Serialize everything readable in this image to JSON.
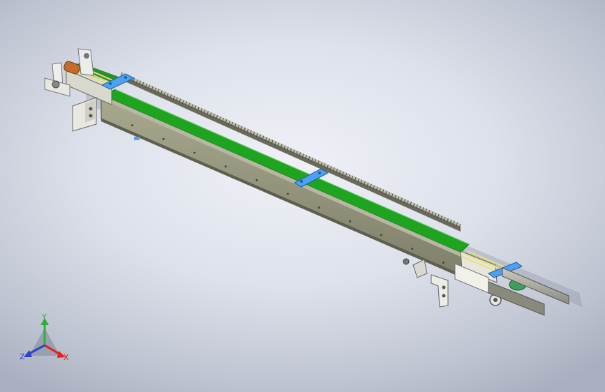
{
  "view": {
    "background_top": "#eef0f6",
    "background_bottom": "#aab0c0"
  },
  "triad": {
    "x_label": "X",
    "y_label": "Y",
    "z_label": "Z",
    "x_color": "#e0211c",
    "y_color": "#2fae3a",
    "z_color": "#2b45c8"
  },
  "model": {
    "belt_color": "#1fa41f",
    "frame_color": "#9a9a80",
    "bracket_color": "#4ea0f0",
    "rail_color": "#a8a89a"
  }
}
